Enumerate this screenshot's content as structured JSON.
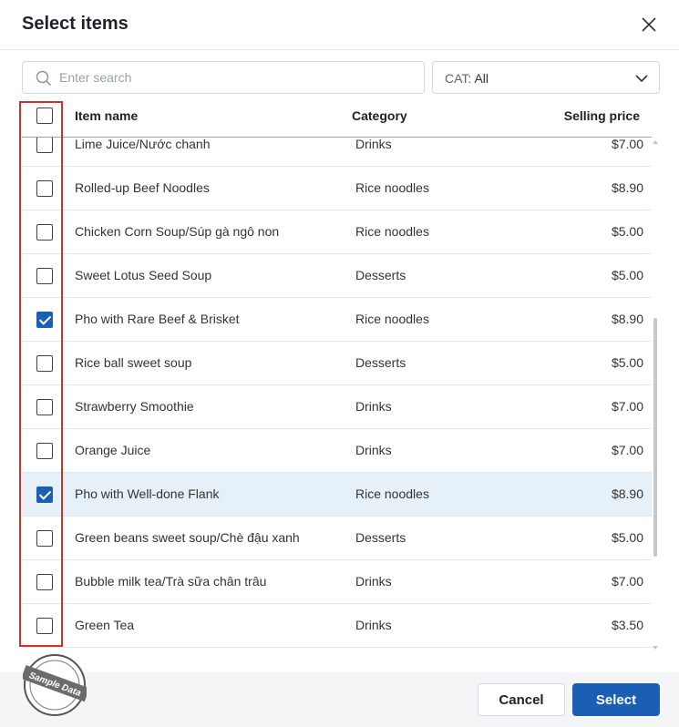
{
  "dialog": {
    "title": "Select items"
  },
  "search": {
    "placeholder": "Enter search",
    "value": ""
  },
  "category_filter": {
    "prefix": "CAT:",
    "value": "All"
  },
  "table": {
    "headers": {
      "name": "Item name",
      "category": "Category",
      "price": "Selling price"
    },
    "rows": [
      {
        "name": "Lime Juice/Nước chanh",
        "category": "Drinks",
        "price": "$7.00",
        "checked": false
      },
      {
        "name": "Rolled-up Beef Noodles",
        "category": "Rice noodles",
        "price": "$8.90",
        "checked": false
      },
      {
        "name": "Chicken Corn Soup/Súp gà ngô non",
        "category": "Rice noodles",
        "price": "$5.00",
        "checked": false
      },
      {
        "name": "Sweet Lotus Seed Soup",
        "category": "Desserts",
        "price": "$5.00",
        "checked": false
      },
      {
        "name": "Pho with Rare Beef & Brisket",
        "category": "Rice noodles",
        "price": "$8.90",
        "checked": true
      },
      {
        "name": "Rice ball sweet soup",
        "category": "Desserts",
        "price": "$5.00",
        "checked": false
      },
      {
        "name": "Strawberry Smoothie",
        "category": "Drinks",
        "price": "$7.00",
        "checked": false
      },
      {
        "name": "Orange Juice",
        "category": "Drinks",
        "price": "$7.00",
        "checked": false
      },
      {
        "name": "Pho with Well-done Flank",
        "category": "Rice noodles",
        "price": "$8.90",
        "checked": true,
        "highlighted": true
      },
      {
        "name": "Green beans sweet soup/Chè đậu xanh",
        "category": "Desserts",
        "price": "$5.00",
        "checked": false
      },
      {
        "name": "Bubble milk tea/Trà sữa chân trâu",
        "category": "Drinks",
        "price": "$7.00",
        "checked": false
      },
      {
        "name": "Green Tea",
        "category": "Drinks",
        "price": "$3.50",
        "checked": false
      }
    ]
  },
  "footer": {
    "cancel_label": "Cancel",
    "select_label": "Select"
  },
  "stamp": {
    "text": "Sample Data"
  },
  "colors": {
    "primary": "#1a5fb4",
    "highlight_row": "#e6f0f9",
    "annotation_frame": "#d0312d"
  },
  "icons": {
    "close": "close-icon",
    "search": "search-icon",
    "dropdown": "chevron-down-icon"
  }
}
